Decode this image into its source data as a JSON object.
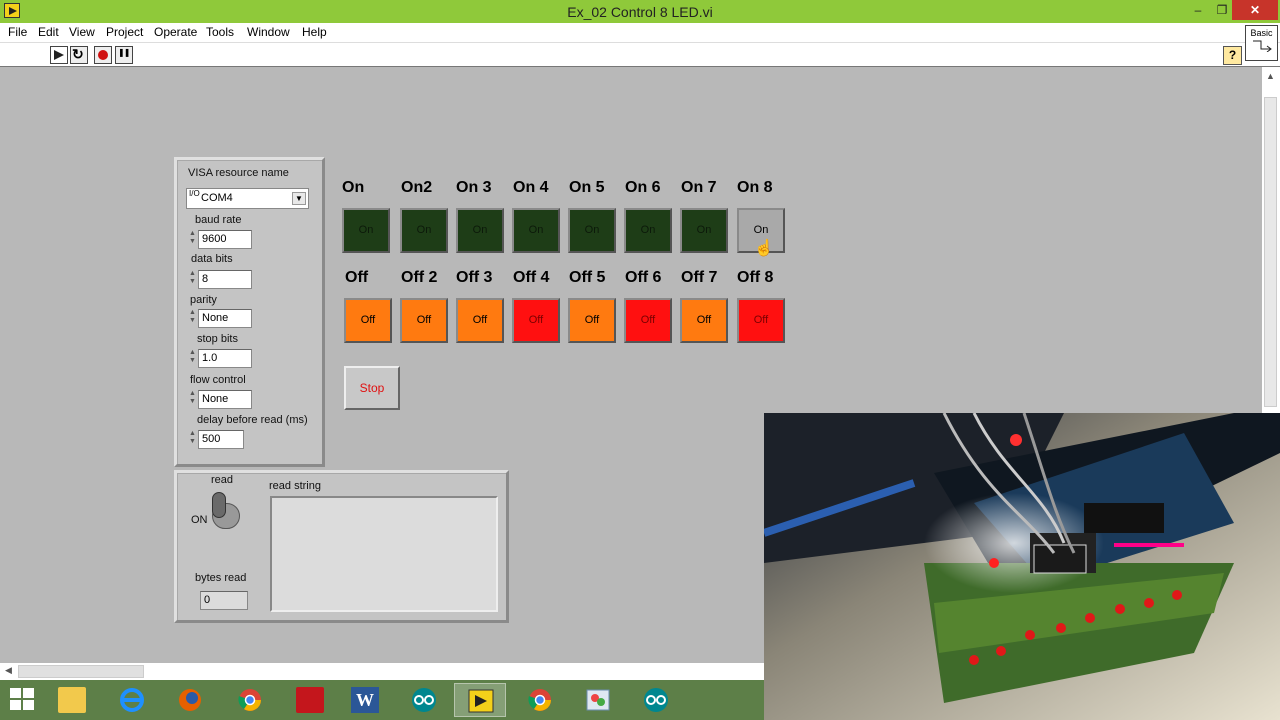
{
  "window": {
    "title": "Ex_02 Control 8 LED.vi",
    "min": "–",
    "max": "❐",
    "close": "✕"
  },
  "menu": [
    "File",
    "Edit",
    "View",
    "Project",
    "Operate",
    "Tools",
    "Window",
    "Help"
  ],
  "toolbar": {
    "help": "?",
    "palette": "Basic"
  },
  "visa": {
    "resource_label": "VISA resource name",
    "resource_tag": "I/O",
    "resource_value": "COM4",
    "baud_label": "baud rate",
    "baud_value": "9600",
    "databits_label": "data bits",
    "databits_value": "8",
    "parity_label": "parity",
    "parity_value": "None",
    "stopbits_label": "stop bits",
    "stopbits_value": "1.0",
    "flow_label": "flow control",
    "flow_value": "None",
    "delay_label": "delay before read (ms)",
    "delay_value": "500"
  },
  "on_buttons": [
    {
      "label": "On",
      "text": "On",
      "state": "on"
    },
    {
      "label": "On2",
      "text": "On",
      "state": "on"
    },
    {
      "label": "On 3",
      "text": "On",
      "state": "on"
    },
    {
      "label": "On 4",
      "text": "On",
      "state": "on"
    },
    {
      "label": "On 5",
      "text": "On",
      "state": "on"
    },
    {
      "label": "On 6",
      "text": "On",
      "state": "on"
    },
    {
      "label": "On 7",
      "text": "On",
      "state": "on"
    },
    {
      "label": "On 8",
      "text": "On",
      "state": "gray"
    }
  ],
  "off_buttons": [
    {
      "label": "Off",
      "text": "Off",
      "state": "orange"
    },
    {
      "label": "Off 2",
      "text": "Off",
      "state": "orange"
    },
    {
      "label": "Off 3",
      "text": "Off",
      "state": "orange"
    },
    {
      "label": "Off 4",
      "text": "Off",
      "state": "red"
    },
    {
      "label": "Off 5",
      "text": "Off",
      "state": "orange"
    },
    {
      "label": "Off 6",
      "text": "Off",
      "state": "red"
    },
    {
      "label": "Off 7",
      "text": "Off",
      "state": "orange"
    },
    {
      "label": "Off 8",
      "text": "Off",
      "state": "red"
    }
  ],
  "stop": {
    "label": "Stop"
  },
  "read_panel": {
    "read_label": "read",
    "toggle_state": "ON",
    "bytes_label": "bytes read",
    "bytes_value": "0",
    "string_label": "read string",
    "string_value": ""
  },
  "colors": {
    "led_on": "#1e3d17",
    "led_orange": "#ff7a10",
    "led_red": "#ff1010",
    "stop_text": "#e01010",
    "titlebar": "#8fc93a"
  },
  "taskbar_apps": [
    "start-icon",
    "file-explorer-icon",
    "internet-explorer-icon",
    "firefox-icon",
    "chrome-icon",
    "acrobat-icon",
    "word-icon",
    "arduino-icon",
    "labview-icon",
    "chrome-icon",
    "paint-icon",
    "arduino-icon"
  ]
}
